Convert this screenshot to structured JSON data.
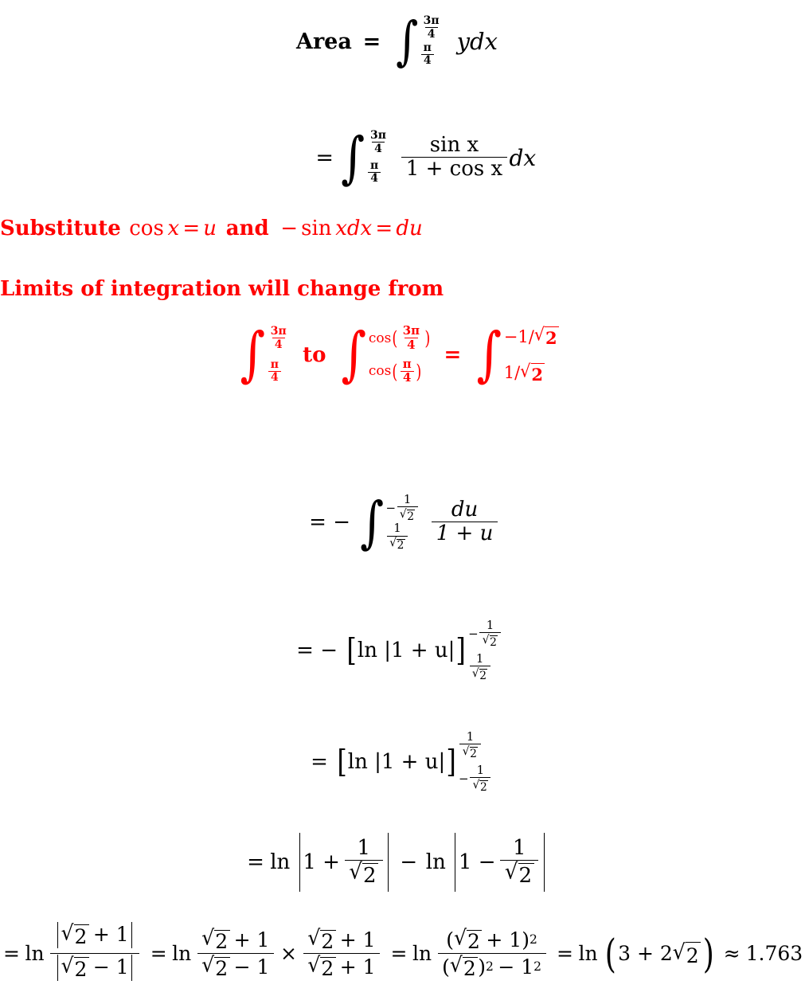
{
  "document": {
    "type": "handwritten-style math derivation",
    "title_text": "Area",
    "text_color": "#000000",
    "accent_color": "#ff0000",
    "background_color": "#ffffff"
  },
  "symbols": {
    "integral": "∫",
    "radical": "√",
    "equals": "=",
    "plus": "+",
    "minus": "−",
    "times": "×",
    "approx": "≈",
    "pi": "π",
    "lparen_big": "(",
    "rparen_big": ")",
    "lbracket": "[",
    "rbracket": "]"
  },
  "lines": {
    "area": {
      "label": "Area",
      "equals": "=",
      "lower_num": "π",
      "lower_den": "4",
      "upper_num": "3π",
      "upper_den": "4",
      "integrand": "ydx"
    },
    "sin_fraction": {
      "equals": "=",
      "lower_num": "π",
      "lower_den": "4",
      "upper_num": "3π",
      "upper_den": "4",
      "numerator": "sin x",
      "denominator": "1 + cos x",
      "differential": "dx"
    },
    "substitute": {
      "lead": "Substitute",
      "expr1_fn": "cos",
      "expr1_arg": "x",
      "expr1_eq": "=",
      "expr1_rhs": "u",
      "conj": "and",
      "expr2_sign": "−",
      "expr2_fn": "sin",
      "expr2_arg": "xdx",
      "expr2_eq": "=",
      "expr2_rhs": "du"
    },
    "limits_note": {
      "text": "Limits of integration will change from"
    },
    "limit_change": {
      "int1_lower_num": "π",
      "int1_lower_den": "4",
      "int1_upper_num": "3π",
      "int1_upper_den": "4",
      "to": "to",
      "int2_lower_fn": "cos",
      "int2_lower_num": "π",
      "int2_lower_den": "4",
      "int2_upper_fn": "cos",
      "int2_upper_num": "3π",
      "int2_upper_den": "4",
      "equals": "=",
      "int3_upper": "−1/√2",
      "int3_upper_sign": "−1/",
      "int3_upper_rad": "2",
      "int3_lower_sign": "1/",
      "int3_lower_rad": "2"
    },
    "du_integral": {
      "equals": "=",
      "minus": "−",
      "upper_sign": "−",
      "upper_num": "1",
      "upper_rad": "2",
      "lower_num": "1",
      "lower_rad": "2",
      "numerator": "du",
      "denominator": "1 + u"
    },
    "eval_negative": {
      "equals": "=",
      "minus": "−",
      "expr": "ln |1 + u|",
      "sup_sign": "−",
      "sup_num": "1",
      "sup_rad": "2",
      "sub_num": "1",
      "sub_rad": "2"
    },
    "eval_positive": {
      "equals": "=",
      "expr": "ln |1 + u|",
      "sup_num": "1",
      "sup_rad": "2",
      "sub_sign": "−",
      "sub_num": "1",
      "sub_rad": "2"
    },
    "ln_difference": {
      "equals": "=",
      "ln1": "ln",
      "term1_lead": "1 +",
      "term1_num": "1",
      "term1_rad": "2",
      "minus": "−",
      "ln2": "ln",
      "term2_lead": "1 −",
      "term2_num": "1",
      "term2_rad": "2"
    },
    "final": {
      "eq1": "=",
      "ln1": "ln",
      "f1_num_rad": "2",
      "f1_num_rest": "+ 1",
      "f1_den_rad": "2",
      "f1_den_rest": "− 1",
      "eq2": "=",
      "ln2": "ln",
      "f2_num_rad": "2",
      "f2_num_rest": "+ 1",
      "f2_den_rad": "2",
      "f2_den_rest": "− 1",
      "times": "×",
      "f3_num_rad": "2",
      "f3_num_rest": "+ 1",
      "f3_den_rad": "2",
      "f3_den_rest": "+ 1",
      "eq3": "=",
      "ln3": "ln",
      "f4_num_rad": "2",
      "f4_num_rest": "+ 1",
      "f4_num_exp": "2",
      "f4_den_rad": "2",
      "f4_den_exp1": "2",
      "f4_den_rest": "− 1",
      "f4_den_exp2": "2",
      "eq4": "=",
      "ln4": "ln",
      "result_lead": "3 + 2",
      "result_rad": "2",
      "approx": "≈",
      "value": "1.763"
    }
  }
}
